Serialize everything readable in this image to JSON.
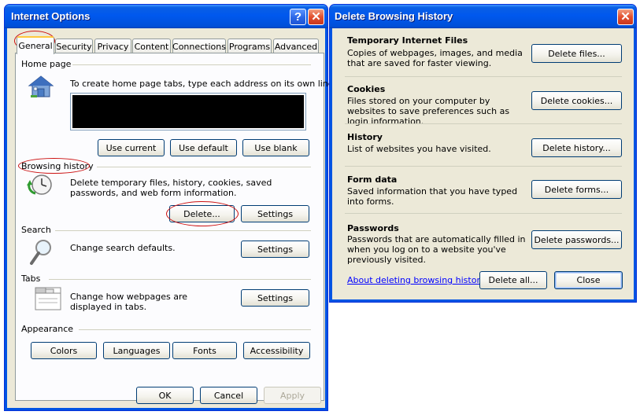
{
  "internet_options": {
    "title": "Internet Options",
    "help_glyph": "?",
    "close_glyph": "✕",
    "tabs": [
      "General",
      "Security",
      "Privacy",
      "Content",
      "Connections",
      "Programs",
      "Advanced"
    ],
    "active_tab": "General",
    "home_page": {
      "label": "Home page",
      "description": "To create home page tabs, type each address on its own line.",
      "address_value": "",
      "buttons": [
        "Use current",
        "Use default",
        "Use blank"
      ]
    },
    "browsing_history": {
      "label": "Browsing history",
      "description": "Delete temporary files, history, cookies, saved passwords, and web form information.",
      "delete_label": "Delete...",
      "settings_label": "Settings"
    },
    "search": {
      "label": "Search",
      "description": "Change search defaults.",
      "settings_label": "Settings"
    },
    "tabs_section": {
      "label": "Tabs",
      "description": "Change how webpages are displayed in tabs.",
      "settings_label": "Settings"
    },
    "appearance": {
      "label": "Appearance",
      "buttons": [
        "Colors",
        "Languages",
        "Fonts",
        "Accessibility"
      ]
    },
    "footer": {
      "ok": "OK",
      "cancel": "Cancel",
      "apply": "Apply"
    }
  },
  "delete_browsing_history": {
    "title": "Delete Browsing History",
    "close_glyph": "✕",
    "sections": [
      {
        "title": "Temporary Internet Files",
        "description": "Copies of webpages, images, and media that are saved for faster viewing.",
        "button": "Delete files..."
      },
      {
        "title": "Cookies",
        "description": "Files stored on your computer by websites to save preferences such as login information.",
        "button": "Delete cookies..."
      },
      {
        "title": "History",
        "description": "List of websites you have visited.",
        "button": "Delete history..."
      },
      {
        "title": "Form data",
        "description": "Saved information that you have typed into forms.",
        "button": "Delete forms..."
      },
      {
        "title": "Passwords",
        "description": "Passwords that are automatically filled in when you log on to a website you've previously visited.",
        "button": "Delete passwords..."
      }
    ],
    "about_link": "About deleting browsing history",
    "delete_all": "Delete all...",
    "close": "Close"
  },
  "colors": {
    "titlebar": "#0054e3",
    "window_face": "#ece9d8",
    "panel": "#fcfcfe",
    "annotation_circle": "#cc1111",
    "link": "#0000ff"
  }
}
